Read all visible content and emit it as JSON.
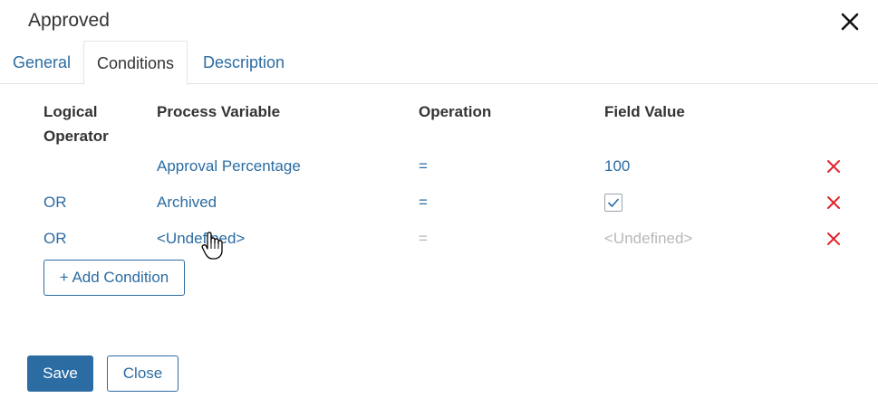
{
  "dialog": {
    "title": "Approved",
    "tabs": [
      {
        "label": "General"
      },
      {
        "label": "Conditions"
      },
      {
        "label": "Description"
      }
    ]
  },
  "table": {
    "headers": {
      "logical_operator_line1": "Logical",
      "logical_operator_line2": "Operator",
      "process_variable": "Process Variable",
      "operation": "Operation",
      "field_value": "Field Value"
    },
    "rows": [
      {
        "operator": "",
        "variable": "Approval Percentage",
        "operation": "=",
        "value": "100",
        "value_type": "text",
        "delete_icon": "x-icon"
      },
      {
        "operator": "OR",
        "variable": "Archived",
        "operation": "=",
        "value": "",
        "value_type": "checkbox",
        "checked": true,
        "delete_icon": "x-icon"
      },
      {
        "operator": "OR",
        "variable": "<Undefined>",
        "operation": "=",
        "value": "<Undefined>",
        "value_type": "text-muted",
        "delete_icon": "x-icon"
      }
    ]
  },
  "buttons": {
    "add_condition": "+ Add Condition",
    "save": "Save",
    "close": "Close"
  },
  "colors": {
    "accent": "#2b6ca3",
    "delete": "#e0262c",
    "muted": "#b8b8b8"
  }
}
